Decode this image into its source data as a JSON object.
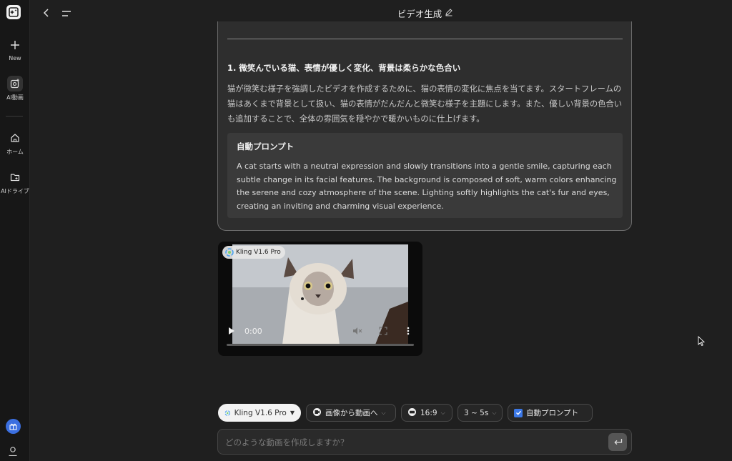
{
  "sidebar": {
    "items": [
      {
        "label": "New",
        "icon": "plus-icon"
      },
      {
        "label": "AI動画",
        "icon": "ai-video-icon"
      },
      {
        "label": "ホーム",
        "icon": "home-icon"
      },
      {
        "label": "AIドライブ",
        "icon": "folder-icon"
      }
    ],
    "bottom_icons": [
      "gift-icon",
      "user-icon"
    ]
  },
  "header": {
    "title": "ビデオ生成",
    "edit_icon": "pencil-icon"
  },
  "card": {
    "heading": "1. 微笑んでいる猫、表情が優しく変化、背景は柔らかな色合い",
    "body": "猫が微笑む様子を強調したビデオを作成するために、猫の表情の変化に焦点を当てます。スタートフレームの猫はあくまで背景として扱い、猫の表情がだんだんと微笑む様子を主題にします。また、優しい背景の色合いも追加することで、全体の雰囲気を穏やかで暖かいものに仕上げます。",
    "prompt_title": "自動プロンプト",
    "prompt_text": "A cat starts with a neutral expression and slowly transitions into a gentle smile, capturing each subtle change in its facial features. The background is composed of soft, warm colors enhancing the serene and cozy atmosphere of the scene. Lighting softly highlights the cat's fur and eyes, creating an inviting and charming visual experience."
  },
  "video": {
    "badge": "Kling V1.6 Pro",
    "time": "0:00",
    "progress": 0
  },
  "toolbar": {
    "model": "Kling V1.6 Pro",
    "mode": "画像から動画へ",
    "ratio": "16:9",
    "duration": "3 ~ 5s",
    "auto_prompt": "自動プロンプト",
    "auto_prompt_checked": true
  },
  "input": {
    "placeholder": "どのような動画を作成しますか？"
  },
  "colors": {
    "accent": "#3b78e7",
    "background": "#1f1f1f",
    "sidebar": "#171717",
    "card": "#2e2e2e"
  }
}
